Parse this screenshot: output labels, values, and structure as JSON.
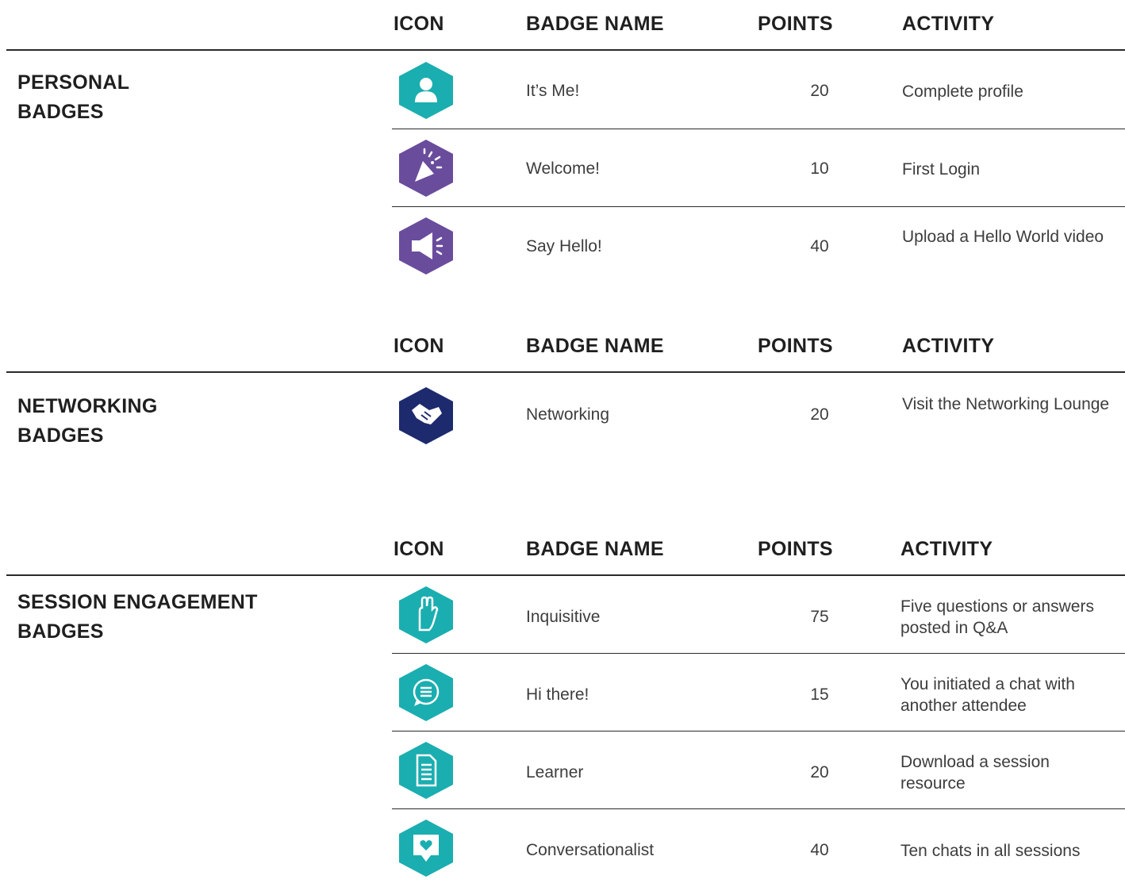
{
  "headers": {
    "icon": "ICON",
    "badge_name": "BADGE NAME",
    "points": "POINTS",
    "activity": "ACTIVITY"
  },
  "colors": {
    "teal": "#1aaeb0",
    "purple": "#6a4c9c",
    "navy": "#1e2a6e"
  },
  "sections": [
    {
      "title_line1": "PERSONAL",
      "title_line2": "BADGES",
      "badges": [
        {
          "icon": "person-icon",
          "color": "teal",
          "name": "It’s Me!",
          "points": "20",
          "activity": "Complete profile"
        },
        {
          "icon": "party-popper-icon",
          "color": "purple",
          "name": "Welcome!",
          "points": "10",
          "activity": "First Login"
        },
        {
          "icon": "megaphone-icon",
          "color": "purple",
          "name": "Say Hello!",
          "points": "40",
          "activity": "Upload a Hello World video"
        }
      ]
    },
    {
      "title_line1": "NETWORKING",
      "title_line2": "BADGES",
      "badges": [
        {
          "icon": "handshake-icon",
          "color": "navy",
          "name": "Networking",
          "points": "20",
          "activity": "Visit the Networking Lounge"
        }
      ]
    },
    {
      "title_line1": "SESSION ENGAGEMENT",
      "title_line2": "BADGES",
      "badges": [
        {
          "icon": "raised-hand-icon",
          "color": "teal",
          "name": "Inquisitive",
          "points": "75",
          "activity": "Five questions or answers posted in Q&A"
        },
        {
          "icon": "chat-bubble-icon",
          "color": "teal",
          "name": "Hi there!",
          "points": "15",
          "activity": "You initiated a chat with another attendee"
        },
        {
          "icon": "document-icon",
          "color": "teal",
          "name": "Learner",
          "points": "20",
          "activity": "Download a session resource"
        },
        {
          "icon": "heart-message-icon",
          "color": "teal",
          "name": "Conversationalist",
          "points": "40",
          "activity": "Ten chats in all sessions"
        }
      ]
    }
  ]
}
